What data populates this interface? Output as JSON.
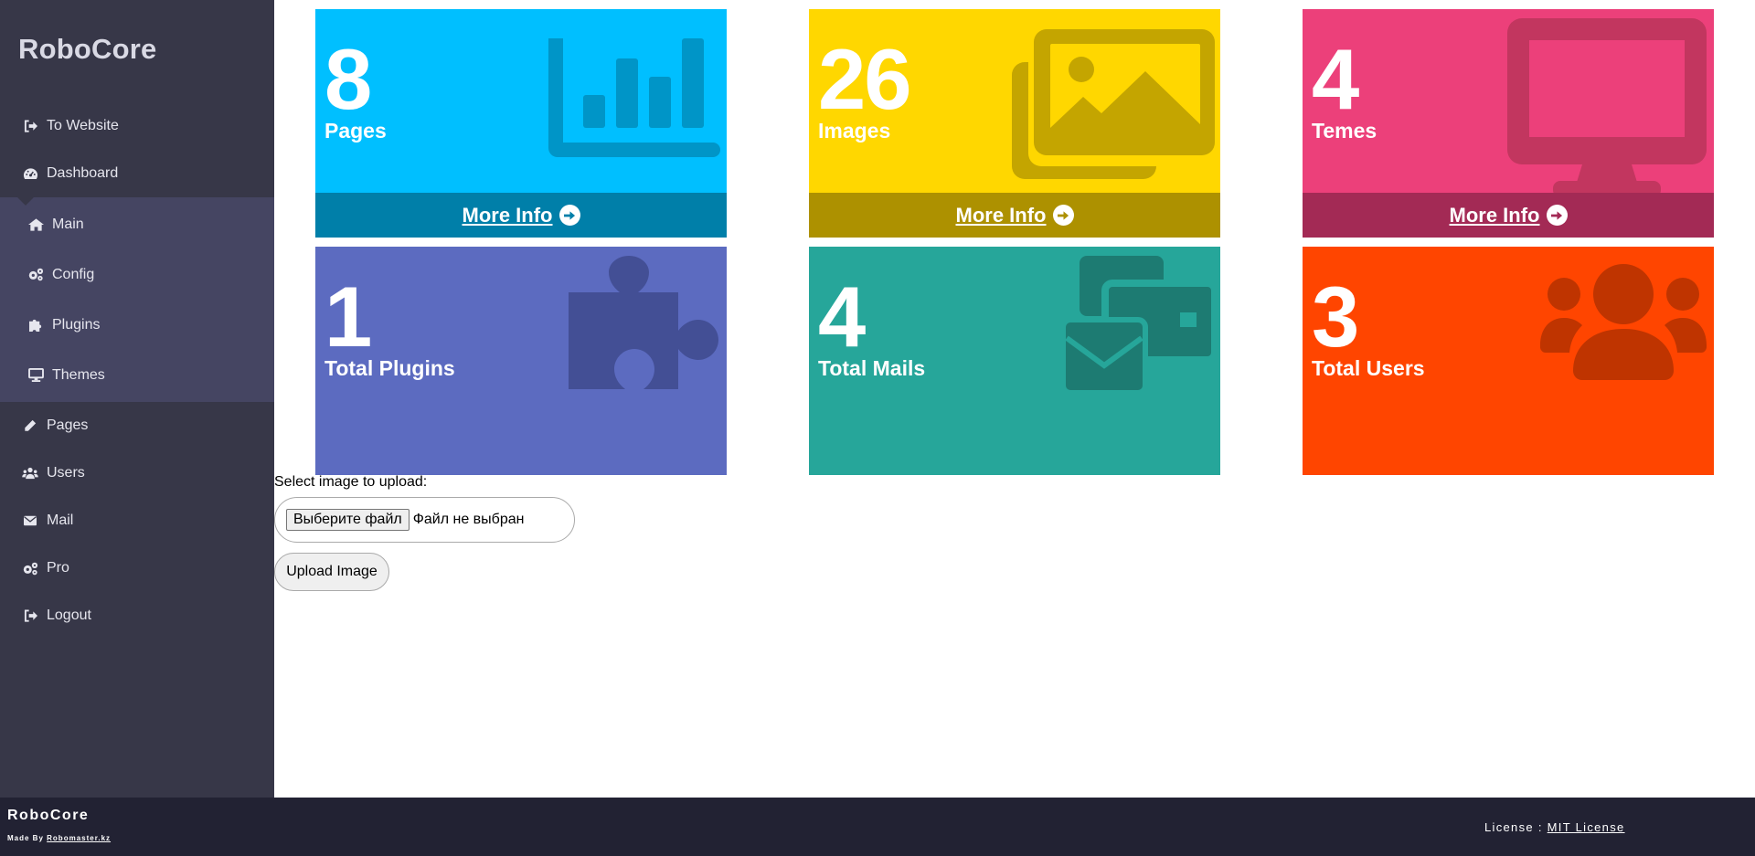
{
  "sidebar": {
    "brand": "RoboCore",
    "items": [
      {
        "label": "To Website",
        "icon": "sign-out-icon"
      },
      {
        "label": "Dashboard",
        "icon": "dashboard-icon"
      }
    ],
    "submenu": [
      {
        "label": "Main",
        "icon": "home-icon"
      },
      {
        "label": "Config",
        "icon": "cogs-icon"
      },
      {
        "label": "Plugins",
        "icon": "puzzle-icon"
      },
      {
        "label": "Themes",
        "icon": "monitor-icon"
      }
    ],
    "items_after": [
      {
        "label": "Pages",
        "icon": "pencil-icon"
      },
      {
        "label": "Users",
        "icon": "users-icon"
      },
      {
        "label": "Mail",
        "icon": "envelope-icon"
      },
      {
        "label": "Pro",
        "icon": "cogs-icon"
      },
      {
        "label": "Logout",
        "icon": "sign-out-icon"
      }
    ]
  },
  "tiles": [
    {
      "count": "8",
      "label": "Pages",
      "more": "More Info",
      "icon": "bar-chart-icon",
      "color": "#00bfff"
    },
    {
      "count": "26",
      "label": "Images",
      "more": "More Info",
      "icon": "images-icon",
      "color": "#ffd700"
    },
    {
      "count": "4",
      "label": "Temes",
      "more": "More Info",
      "icon": "monitor-icon",
      "color": "#ec407a"
    },
    {
      "count": "1",
      "label": "Total Plugins",
      "icon": "puzzle-icon",
      "color": "#5c6bc0"
    },
    {
      "count": "4",
      "label": "Total Mails",
      "icon": "envelopes-icon",
      "color": "#26a69a"
    },
    {
      "count": "3",
      "label": "Total Users",
      "icon": "users-icon",
      "color": "#ff4500"
    }
  ],
  "upload": {
    "label": "Select image to upload:",
    "choose_button": "Выберите файл",
    "file_status": "Файл не выбран",
    "submit": "Upload Image"
  },
  "footer": {
    "brand": "RoboCore",
    "made_by_prefix": "Made By",
    "made_by_link": "Robomaster.kz",
    "license_prefix": "License :",
    "license_link": "MIT License"
  }
}
